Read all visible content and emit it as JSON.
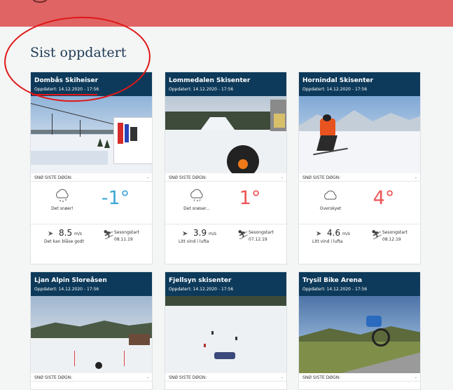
{
  "header": {
    "title": "Sist oppdatert"
  },
  "labels": {
    "snow": "SNØ SISTE DØGN:",
    "snow_value": "-",
    "wind_unit": "m/s",
    "season_start": "Sesongstart"
  },
  "cards": [
    {
      "name": "Dombås Skiheiser",
      "updated": "Oppdatert: 14.12.2020 - 17:56",
      "weather": "Det snøer!",
      "temp": "-1°",
      "wind": "8.5",
      "wind_desc": "Det kan blåse godt",
      "season_date": "08.11.19"
    },
    {
      "name": "Lommedalen Skisenter",
      "updated": "Oppdatert: 14.12.2020 - 17:56",
      "weather": "Det snøser...",
      "temp": "1°",
      "wind": "3.9",
      "wind_desc": "Litt vind i lufta",
      "season_date": "07.12.19"
    },
    {
      "name": "Hornindal Skisenter",
      "updated": "Oppdatert: 14.12.2020 - 17:56",
      "weather": "Overskyet",
      "temp": "4°",
      "wind": "4.6",
      "wind_desc": "Litt vind i lufta",
      "season_date": "08.12.19"
    },
    {
      "name": "Ljan Alpin Sloreåsen",
      "updated": "Oppdatert: 14.12.2020 - 17:56"
    },
    {
      "name": "Fjellsyn skisenter",
      "updated": "Oppdatert: 14.12.2020 - 17:56"
    },
    {
      "name": "Trysil Bike Arena",
      "updated": "Oppdatert: 14.12.2020 - 17:56"
    }
  ],
  "colors": {
    "header_bar": "#e06464",
    "card_head": "#0d3a5a",
    "cold_temp": "#3fa7d4",
    "warm_temp": "#ee5555",
    "annotation": "#e01818"
  }
}
